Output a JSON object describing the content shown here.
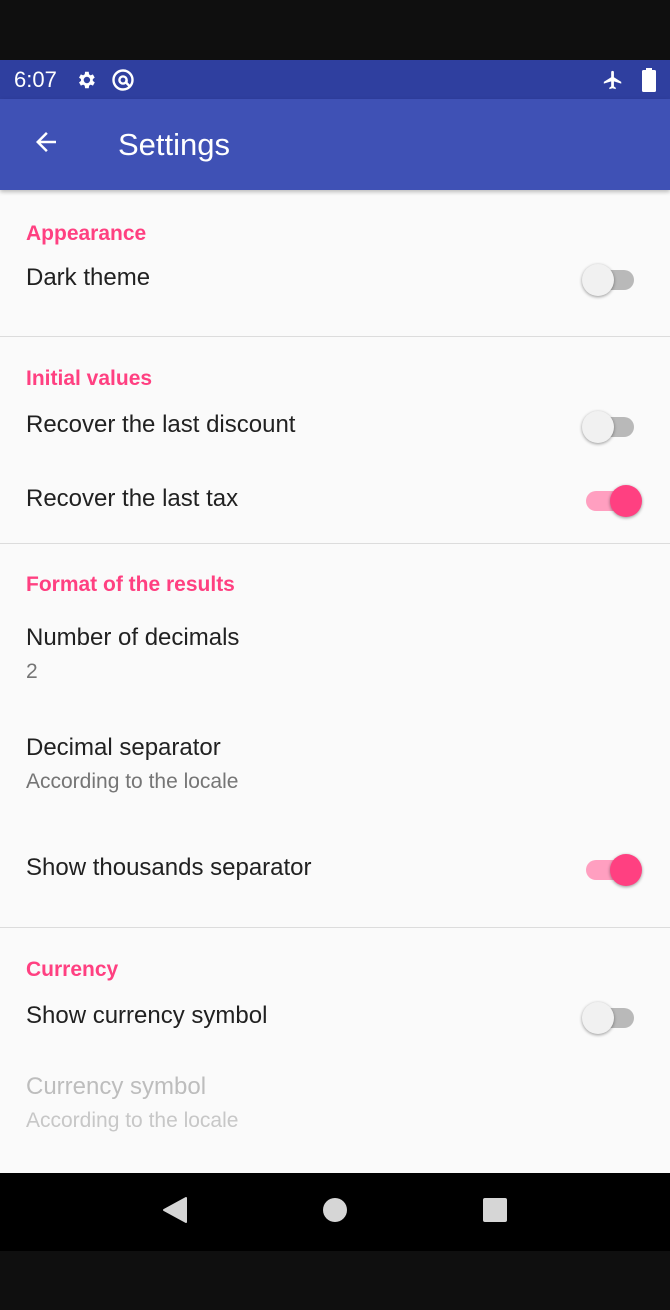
{
  "status_bar": {
    "time": "6:07",
    "icons_left": [
      "gear-icon",
      "at-sign-icon"
    ],
    "icons_right": [
      "airplane-icon",
      "battery-icon"
    ],
    "background": "#2f3f9f"
  },
  "app_bar": {
    "title": "Settings",
    "back_icon": "arrow-back-icon",
    "background": "#3f51b5"
  },
  "accent_color": "#ff4081",
  "sections": {
    "appearance": {
      "header": "Appearance",
      "dark_theme": {
        "title": "Dark theme",
        "enabled": false
      }
    },
    "initial_values": {
      "header": "Initial values",
      "recover_discount": {
        "title": "Recover the last discount",
        "enabled": false
      },
      "recover_tax": {
        "title": "Recover the last tax",
        "enabled": true
      }
    },
    "format": {
      "header": "Format of the results",
      "decimals": {
        "title": "Number of decimals",
        "summary": "2"
      },
      "decimal_separator": {
        "title": "Decimal separator",
        "summary": "According to the locale"
      },
      "thousands_separator": {
        "title": "Show thousands separator",
        "enabled": true
      }
    },
    "currency": {
      "header": "Currency",
      "show_symbol": {
        "title": "Show currency symbol",
        "enabled": false
      },
      "symbol": {
        "title": "Currency symbol",
        "summary": "According to the locale",
        "disabled": true
      }
    }
  },
  "nav_bar": {
    "buttons": [
      "back-triangle-icon",
      "home-circle-icon",
      "recents-square-icon"
    ]
  }
}
